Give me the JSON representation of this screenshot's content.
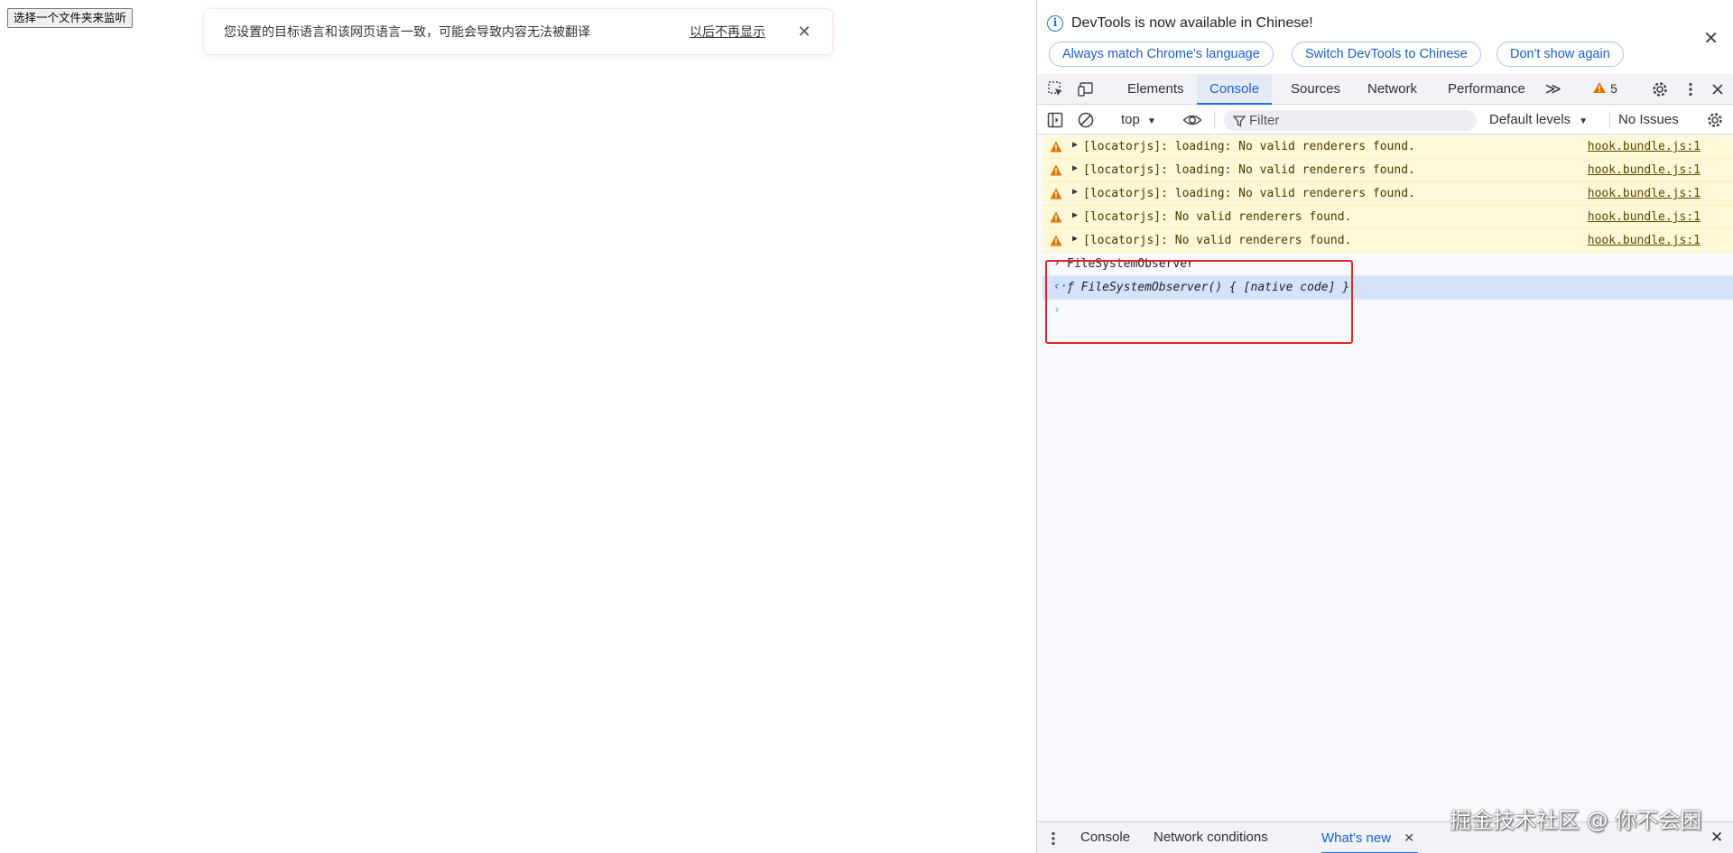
{
  "page": {
    "pick_button": "选择一个文件夹来监听",
    "translate_bar": {
      "message": "您设置的目标语言和该网页语言一致，可能会导致内容无法被翻译",
      "dismiss_link": "以后不再显示",
      "close_glyph": "✕"
    }
  },
  "devtools": {
    "infobar": {
      "title": "DevTools is now available in Chinese!",
      "buttons": [
        "Always match Chrome's language",
        "Switch DevTools to Chinese",
        "Don't show again"
      ],
      "close_glyph": "✕"
    },
    "tabs": [
      "Elements",
      "Console",
      "Sources",
      "Network",
      "Performance"
    ],
    "active_tab": "Console",
    "more_tabs_glyph": "≫",
    "warning_count": "5",
    "toolbar": {
      "context": "top",
      "filter_placeholder": "Filter",
      "levels": "Default levels",
      "issues": "No Issues"
    },
    "console": {
      "warnings": [
        {
          "message": "[locatorjs]: loading: No valid renderers found.",
          "source": "hook.bundle.js:1"
        },
        {
          "message": "[locatorjs]: loading: No valid renderers found.",
          "source": "hook.bundle.js:1"
        },
        {
          "message": "[locatorjs]: loading: No valid renderers found.",
          "source": "hook.bundle.js:1"
        },
        {
          "message": "[locatorjs]: No valid renderers found.",
          "source": "hook.bundle.js:1"
        },
        {
          "message": "[locatorjs]: No valid renderers found.",
          "source": "hook.bundle.js:1"
        }
      ],
      "input_glyph": "›",
      "command": "FileSystemObserver",
      "result_glyph": "‹·",
      "result": "ƒ FileSystemObserver() { [native code] }",
      "prompt_glyph": "›"
    },
    "drawer": {
      "tabs": [
        "Console",
        "Network conditions",
        "What's new"
      ],
      "active_tab": "What's new",
      "close_glyph": "✕"
    }
  },
  "watermark": "掘金技术社区 @ 你不会困",
  "colors": {
    "accent": "#1a73e8",
    "warning_bg": "#fef7d8",
    "warning_icon": "#e37400",
    "highlight_box": "#e32525",
    "result_bg": "#d3e3fc"
  }
}
